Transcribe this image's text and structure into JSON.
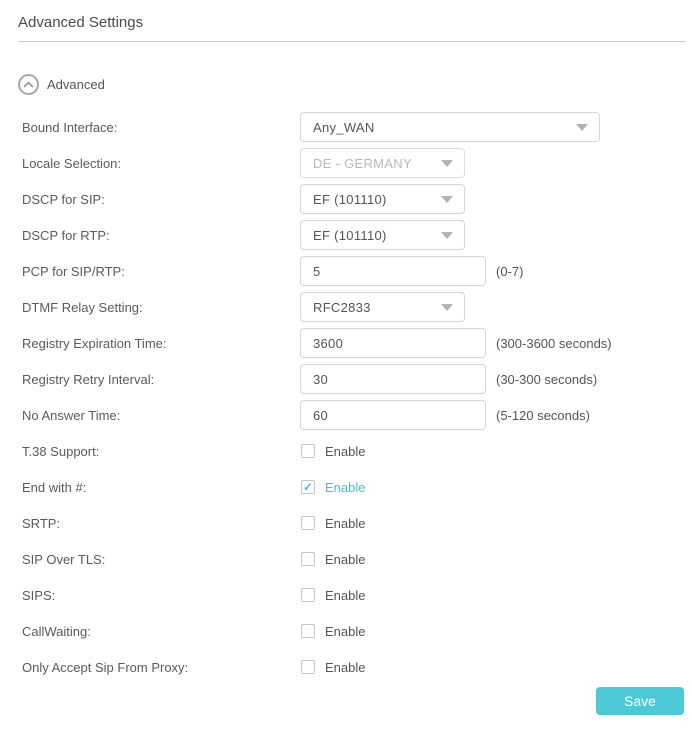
{
  "header": {
    "title": "Advanced Settings"
  },
  "section": {
    "toggle_label": "Advanced",
    "toggle_icon": "chevron-up-circle-icon"
  },
  "form": {
    "rows": [
      {
        "type": "select",
        "name": "bound-interface",
        "label": "Bound Interface:",
        "value": "Any_WAN",
        "width": "wide"
      },
      {
        "type": "select",
        "name": "locale-selection",
        "label": "Locale Selection:",
        "value": "DE - GERMANY",
        "width": "normal",
        "disabled": true
      },
      {
        "type": "select",
        "name": "dscp-for-sip",
        "label": "DSCP for SIP:",
        "value": "EF (101110)",
        "width": "normal"
      },
      {
        "type": "select",
        "name": "dscp-for-rtp",
        "label": "DSCP for RTP:",
        "value": "EF (101110)",
        "width": "normal"
      },
      {
        "type": "text",
        "name": "pcp-for-sip-rtp",
        "label": "PCP for SIP/RTP:",
        "value": "5",
        "hint": "(0-7)"
      },
      {
        "type": "select",
        "name": "dtmf-relay-setting",
        "label": "DTMF Relay Setting:",
        "value": "RFC2833",
        "width": "normal"
      },
      {
        "type": "text",
        "name": "registry-expiration-time",
        "label": "Registry Expiration Time:",
        "value": "3600",
        "hint": "(300-3600 seconds)"
      },
      {
        "type": "text",
        "name": "registry-retry-interval",
        "label": "Registry Retry Interval:",
        "value": "30",
        "hint": "(30-300 seconds)"
      },
      {
        "type": "text",
        "name": "no-answer-time",
        "label": "No Answer Time:",
        "value": "60",
        "hint": "(5-120 seconds)"
      },
      {
        "type": "checkbox",
        "name": "t38-support",
        "label": "T.38 Support:",
        "checkbox_label": "Enable",
        "checked": false
      },
      {
        "type": "checkbox",
        "name": "end-with-pound",
        "label": "End with #:",
        "checkbox_label": "Enable",
        "checked": true
      },
      {
        "type": "checkbox",
        "name": "srtp",
        "label": "SRTP:",
        "checkbox_label": "Enable",
        "checked": false
      },
      {
        "type": "checkbox",
        "name": "sip-over-tls",
        "label": "SIP Over TLS:",
        "checkbox_label": "Enable",
        "checked": false
      },
      {
        "type": "checkbox",
        "name": "sips",
        "label": "SIPS:",
        "checkbox_label": "Enable",
        "checked": false
      },
      {
        "type": "checkbox",
        "name": "callwaiting",
        "label": "CallWaiting:",
        "checkbox_label": "Enable",
        "checked": false
      },
      {
        "type": "checkbox",
        "name": "only-accept-sip-from-proxy",
        "label": "Only Accept Sip From Proxy:",
        "checkbox_label": "Enable",
        "checked": false
      }
    ]
  },
  "footer": {
    "save_label": "Save"
  },
  "icons": {
    "check": "✓",
    "chevron_down": "css-triangle",
    "chevron_up": "svg-chevron"
  },
  "colors": {
    "accent": "#4cc9d4",
    "checked_text": "#3ec4ce",
    "divider": "#cccccc",
    "field_border": "#d5d5d5",
    "text": "#555555",
    "disabled_text": "#b9b9b9"
  }
}
